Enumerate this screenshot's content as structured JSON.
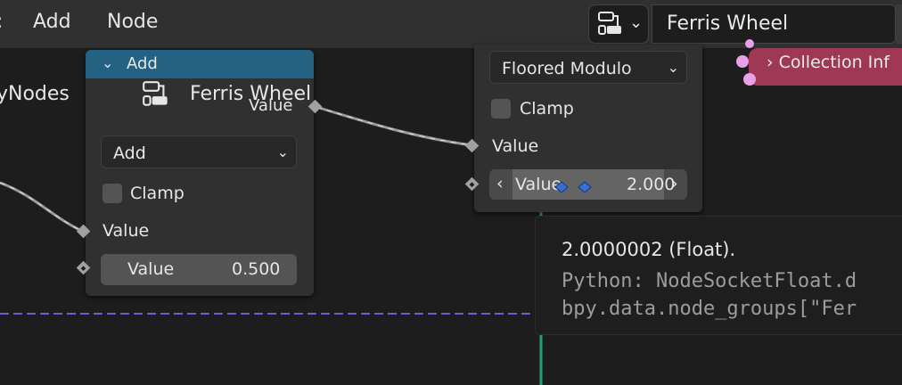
{
  "header": {
    "menus": [
      "Add",
      "Node"
    ],
    "tree_type_icon": "node-tree-icon",
    "tree_name": "Ferris Wheel"
  },
  "breadcrumb": {
    "parent_fragment": "yNodes",
    "arrow": "›",
    "current": "Ferris Wheel"
  },
  "node_add": {
    "title": "Add",
    "output_label": "Value",
    "operation": "Add",
    "clamp_label": "Clamp",
    "input_label": "Value",
    "field_label": "Value",
    "field_value": "0.500"
  },
  "node_modulo": {
    "operation": "Floored Modulo",
    "clamp_label": "Clamp",
    "input_label": "Value",
    "field_label": "Value",
    "field_value": "2.000"
  },
  "collection_node": {
    "title": "› Collection Inf"
  },
  "tooltip": {
    "line1": "2.0000002 (Float).",
    "line2": "Python: NodeSocketFloat.d",
    "line3": "bpy.data.node_groups[\"Fer"
  },
  "colors": {
    "header_bg": "#303030",
    "canvas_bg": "#1d1d1d",
    "node_bg": "#303030",
    "math_header": "#246283",
    "collection_header": "#9e3855",
    "socket_float": "#a1a1a1",
    "socket_geometry": "#e8a0e8",
    "frame_line": "#6a5cd6",
    "green_link": "#1ea07d"
  }
}
